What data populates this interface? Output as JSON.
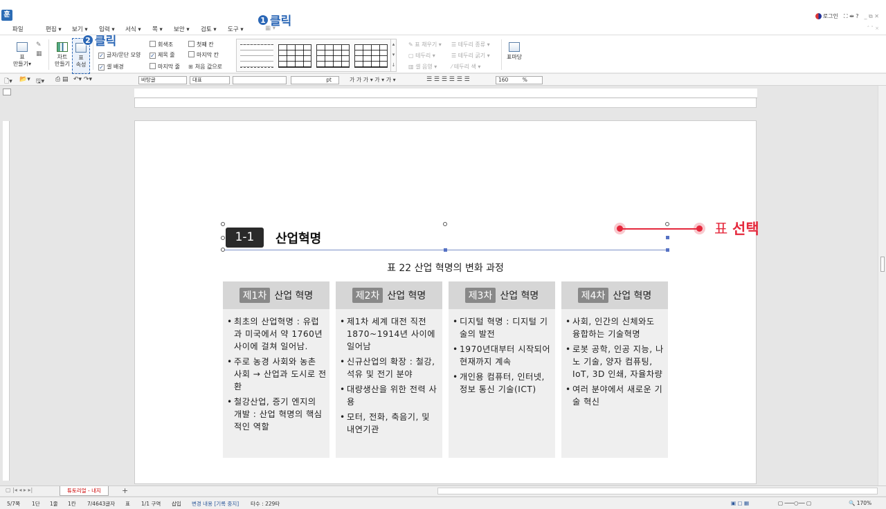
{
  "menu": [
    "파일",
    "편집 ▾",
    "보기 ▾",
    "입력 ▾",
    "서식 ▾",
    "쪽 ▾",
    "보안 ▾",
    "검토 ▾",
    "도구 ▾"
  ],
  "header_right": {
    "login": "로그인",
    "icons": "⛶ ⇹ ?",
    "window": "_ ⧉ ✕"
  },
  "ribbon": {
    "table_make": "표\n만들기▾",
    "chart_make": "차트\n만들기",
    "table_prop": "표\n속성",
    "checks": [
      {
        "label": "글자/문단 모양",
        "checked": true
      },
      {
        "label": "셀 배경",
        "checked": true
      },
      {
        "label": "회색조",
        "checked": false
      },
      {
        "label": "제목 줄",
        "checked": true
      },
      {
        "label": "마지막 줄",
        "checked": false
      },
      {
        "label": "첫째 칸",
        "checked": false
      },
      {
        "label": "마지막 칸",
        "checked": false
      }
    ],
    "reset_style": "처음 값으로",
    "disabled": [
      "표 채우기 ▾",
      "테두리 ▾",
      "셀 음영 ▾",
      "테두리 종류 ▾",
      "테두리 굵기 ▾",
      "테두리 색 ▾"
    ],
    "table_draw": "표마당"
  },
  "format": {
    "style": "바탕글",
    "font_kind": "대표",
    "font": "",
    "size_unit": "pt",
    "zoom": "160",
    "zoom_unit": "%"
  },
  "document": {
    "chapter_no": "1-1",
    "chapter_title": "산업혁명",
    "caption": "표 22 산업 혁명의 변화 과정",
    "columns": [
      {
        "badge": "제1차",
        "title": "산업 혁명",
        "items": [
          "최초의 산업혁명 : 유럽과 미국에서 약 1760년사이에 걸쳐 일어남.",
          "주로 농경 사회와 농촌 사회 → 산업과 도시로 전환",
          "철강산업, 증기 엔지의 개발 : 산업 혁명의 핵심적인 역할"
        ]
      },
      {
        "badge": "제2차",
        "title": "산업 혁명",
        "items": [
          "제1차 세계 대전 직전 1870~1914년 사이에 일어남",
          "신규산업의 확장 : 철강, 석유 및 전기 분야",
          "대량생산을 위한 전력 사용",
          "모터, 전화, 축음기, 및 내연기관"
        ]
      },
      {
        "badge": "제3차",
        "title": "산업 혁명",
        "items": [
          "디지털 혁명 : 디지털 기술의 발전",
          "1970년대부터 시작되어 현재까지 계속",
          "개인용 컴퓨터, 인터넷, 정보 통신 기술(ICT)"
        ]
      },
      {
        "badge": "제4차",
        "title": "산업 혁명",
        "items": [
          "사회, 인간의 신체와도 융합하는 기술혁명",
          "로봇 공학, 인공 지능, 나노 기술, 양자 컴퓨팅, IoT, 3D 인쇄, 자율차량",
          "여러 분야에서 새로운 기술 혁신"
        ]
      }
    ]
  },
  "annotations": {
    "step1": {
      "num": "1",
      "text": "클릭"
    },
    "step2": {
      "num": "2",
      "text": "클릭"
    },
    "select_label_a": "표 ",
    "select_label_b": "선택"
  },
  "tabs": {
    "active": "튜토리얼 - 내지",
    "add": "+"
  },
  "status": [
    "5/7쪽",
    "1단",
    "1줄",
    "1칸",
    "7/4643글자",
    "표",
    "1/1 구역",
    "삽입",
    "변경 내용 [기록 중지]",
    "타수 : 229타"
  ],
  "status_zoom": "170%",
  "colors": {
    "annotation_blue": "#2b67b6",
    "annotation_red": "#e5283c",
    "chapter_box": "#2a2a2a"
  }
}
